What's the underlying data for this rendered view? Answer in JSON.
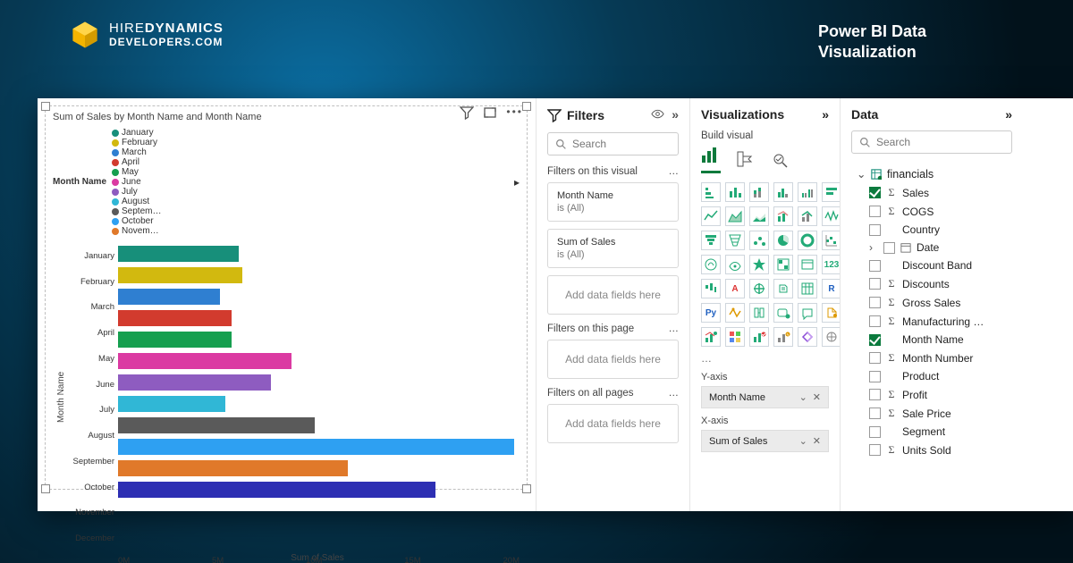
{
  "brand": {
    "line1_a": "HIRE",
    "line1_b": "DYNAMICS",
    "line2_a": "DEVELOPERS",
    "line2_b": ".COM"
  },
  "tagline": "Power BI Data Visualization",
  "chart_data": {
    "type": "bar",
    "orientation": "horizontal",
    "title": "Sum of Sales by Month Name and Month Name",
    "legend_title": "Month Name",
    "xlabel": "Sum of Sales",
    "ylabel": "Month Name",
    "xlim": [
      0,
      22000000
    ],
    "xticks": [
      "0M",
      "5M",
      "10M",
      "15M",
      "20M"
    ],
    "categories": [
      "January",
      "February",
      "March",
      "April",
      "May",
      "June",
      "July",
      "August",
      "September",
      "October",
      "November",
      "December"
    ],
    "values": [
      6600000,
      6800000,
      5600000,
      6200000,
      6200000,
      9500000,
      8400000,
      5900000,
      10800000,
      21700000,
      12600000,
      17400000
    ],
    "colors": [
      "#178f7a",
      "#d2b90f",
      "#2f7fd1",
      "#d23b2e",
      "#169f4f",
      "#db3aa2",
      "#8e5cc0",
      "#30b7d6",
      "#5a5a5a",
      "#2ea0f2",
      "#e0792a",
      "#2d2fb3"
    ],
    "legend_items": [
      {
        "label": "January",
        "color": "#178f7a"
      },
      {
        "label": "February",
        "color": "#d2b90f"
      },
      {
        "label": "March",
        "color": "#2f7fd1"
      },
      {
        "label": "April",
        "color": "#d23b2e"
      },
      {
        "label": "May",
        "color": "#169f4f"
      },
      {
        "label": "June",
        "color": "#db3aa2"
      },
      {
        "label": "July",
        "color": "#8e5cc0"
      },
      {
        "label": "August",
        "color": "#30b7d6"
      },
      {
        "label": "Septem…",
        "color": "#5a5a5a"
      },
      {
        "label": "October",
        "color": "#2ea0f2"
      },
      {
        "label": "Novem…",
        "color": "#e0792a"
      }
    ]
  },
  "filters": {
    "title": "Filters",
    "search_placeholder": "Search",
    "sections": {
      "visual": "Filters on this visual",
      "page": "Filters on this page",
      "all": "Filters on all pages"
    },
    "applied": [
      {
        "field": "Month Name",
        "summary": "is (All)"
      },
      {
        "field": "Sum of Sales",
        "summary": "is (All)"
      }
    ],
    "drop_placeholder": "Add data fields here"
  },
  "vis": {
    "title": "Visualizations",
    "subtitle": "Build visual",
    "yaxis_label": "Y-axis",
    "xaxis_label": "X-axis",
    "yaxis_value": "Month Name",
    "xaxis_value": "Sum of Sales"
  },
  "data": {
    "title": "Data",
    "search_placeholder": "Search",
    "table": "financials",
    "fields": [
      {
        "name": "Sales",
        "sigma": true,
        "checked": true
      },
      {
        "name": "COGS",
        "sigma": true,
        "checked": false
      },
      {
        "name": "Country",
        "sigma": false,
        "checked": false
      },
      {
        "name": "Date",
        "sigma": false,
        "checked": false,
        "expandable": true,
        "icon": "date"
      },
      {
        "name": "Discount Band",
        "sigma": false,
        "checked": false
      },
      {
        "name": "Discounts",
        "sigma": true,
        "checked": false
      },
      {
        "name": "Gross Sales",
        "sigma": true,
        "checked": false
      },
      {
        "name": "Manufacturing …",
        "sigma": true,
        "checked": false
      },
      {
        "name": "Month Name",
        "sigma": false,
        "checked": true
      },
      {
        "name": "Month Number",
        "sigma": true,
        "checked": false
      },
      {
        "name": "Product",
        "sigma": false,
        "checked": false
      },
      {
        "name": "Profit",
        "sigma": true,
        "checked": false
      },
      {
        "name": "Sale Price",
        "sigma": true,
        "checked": false
      },
      {
        "name": "Segment",
        "sigma": false,
        "checked": false
      },
      {
        "name": "Units Sold",
        "sigma": true,
        "checked": false
      }
    ]
  }
}
